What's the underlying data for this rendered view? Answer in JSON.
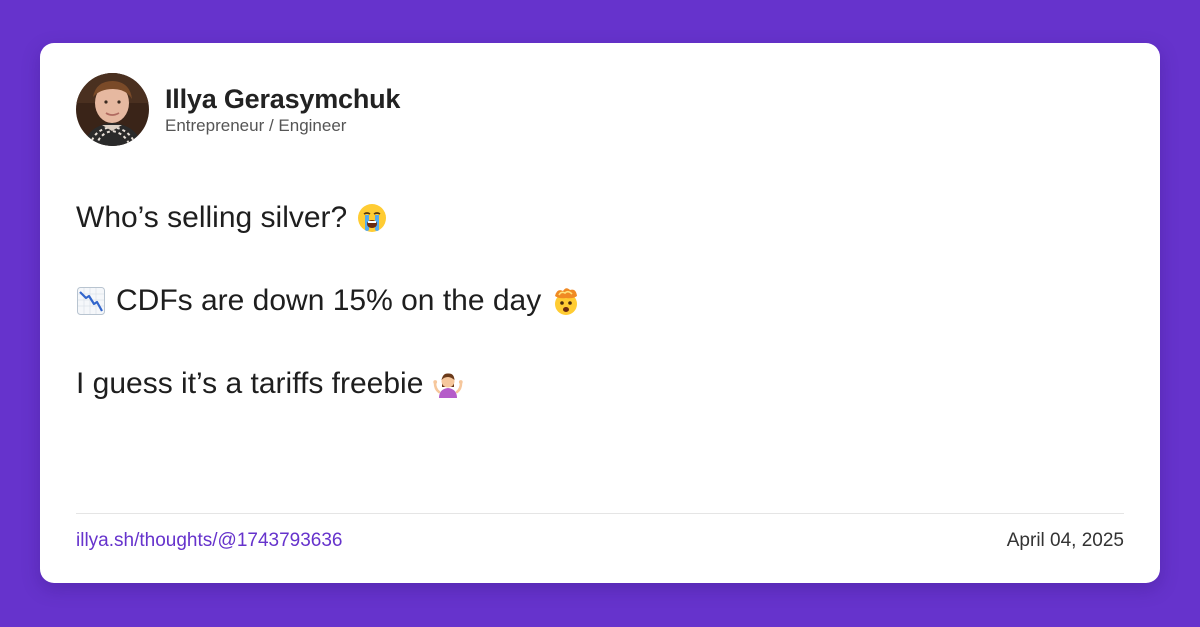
{
  "author": {
    "name": "Illya Gerasymchuk",
    "role": "Entrepreneur / Engineer"
  },
  "post": {
    "line1": "Who’s selling silver?",
    "line2": "CDFs are down 15% on the day",
    "line3": "I guess it’s a tariffs freebie"
  },
  "icons": {
    "line1": "loudly-crying-face-emoji",
    "line2_before": "chart-decreasing-emoji",
    "line2_after": "exploding-head-emoji",
    "line3": "person-shrugging-emoji"
  },
  "footer": {
    "link": "illya.sh/thoughts/@1743793636",
    "date": "April 04, 2025"
  },
  "colors": {
    "background": "#6633cc",
    "card": "#ffffff",
    "link": "#6633cc"
  }
}
